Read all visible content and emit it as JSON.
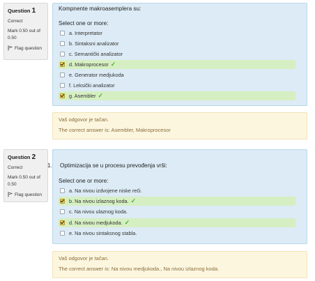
{
  "questions": [
    {
      "label": "Question",
      "number": "1",
      "state": "Correct",
      "grade": "Mark 0.50 out of 0.50",
      "flag": "Flag question",
      "text": "Kompnente makroasemplera su:",
      "prompt": "Select one or more:",
      "answers": [
        {
          "label": "a. Interpretator",
          "checked": false,
          "correct": false
        },
        {
          "label": "b. Sintaksni analizator",
          "checked": false,
          "correct": false
        },
        {
          "label": "c. Semantički analizator",
          "checked": false,
          "correct": false
        },
        {
          "label": "d. Makroprocesor",
          "checked": true,
          "correct": true
        },
        {
          "label": "e. Generator medjukoda",
          "checked": false,
          "correct": false
        },
        {
          "label": "f. Leksički analizator",
          "checked": false,
          "correct": false
        },
        {
          "label": "g. Asembler",
          "checked": true,
          "correct": true
        }
      ],
      "feedback": "Vaš odgovor je tačan.",
      "right_answer": "The correct answer is: Asembler, Makroprocesor"
    },
    {
      "label": "Question",
      "number": "2",
      "state": "Correct",
      "grade": "Mark 0.50 out of 0.50",
      "flag": "Flag question",
      "list_number": "1.",
      "text": "Optimizacija se u procesu prevođenja vrši:",
      "prompt": "Select one or more:",
      "answers": [
        {
          "label": "a. Na nivou izdvojene niske reči.",
          "checked": false,
          "correct": false
        },
        {
          "label": "b. Na nivou izlaznog koda.",
          "checked": true,
          "correct": true
        },
        {
          "label": "c. Na nivou ulaznog koda.",
          "checked": false,
          "correct": false
        },
        {
          "label": "d. Na nivou medjukoda.",
          "checked": true,
          "correct": true
        },
        {
          "label": "e. Na nivou sintaksnog stabla.",
          "checked": false,
          "correct": false
        }
      ],
      "feedback": "Vaš odgovor je tačan.",
      "right_answer": "The correct answer is: Na nivou medjukoda., Na nivou izlaznog koda."
    }
  ],
  "colors": {
    "formulation_bg": "#dcebf5",
    "correct_answer_bg": "#d6efc2",
    "feedback_bg": "#fcf6df",
    "feedback_text": "#8a6d3b",
    "tick": "#4caf2e"
  }
}
